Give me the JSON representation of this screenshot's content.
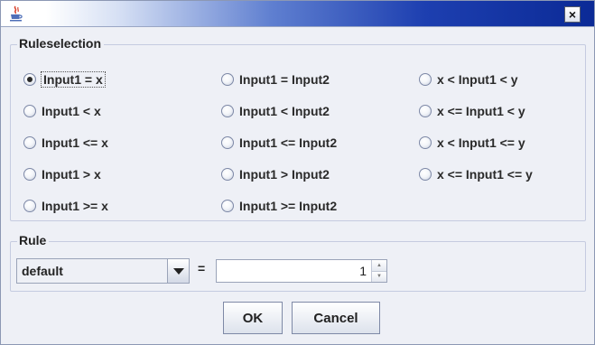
{
  "window": {
    "close_symbol": "×",
    "app_icon": "java-cup-icon",
    "title_gradient_color": "#0b2a96"
  },
  "ruleselection": {
    "legend": "Ruleselection",
    "options": [
      {
        "label": "Input1 = x",
        "selected": true
      },
      {
        "label": "Input1 < x",
        "selected": false
      },
      {
        "label": "Input1 <= x",
        "selected": false
      },
      {
        "label": "Input1 > x",
        "selected": false
      },
      {
        "label": "Input1 >= x",
        "selected": false
      },
      {
        "label": "Input1 = Input2",
        "selected": false
      },
      {
        "label": "Input1 < Input2",
        "selected": false
      },
      {
        "label": "Input1 <= Input2",
        "selected": false
      },
      {
        "label": "Input1 > Input2",
        "selected": false
      },
      {
        "label": "Input1 >= Input2",
        "selected": false
      },
      {
        "label": "x < Input1 < y",
        "selected": false
      },
      {
        "label": "x <= Input1 < y",
        "selected": false
      },
      {
        "label": "x < Input1 <= y",
        "selected": false
      },
      {
        "label": "x <= Input1 <= y",
        "selected": false
      }
    ]
  },
  "rule": {
    "legend": "Rule",
    "combo_value": "default",
    "equals": "=",
    "spinner_value": "1"
  },
  "buttons": {
    "ok": "OK",
    "cancel": "Cancel"
  }
}
